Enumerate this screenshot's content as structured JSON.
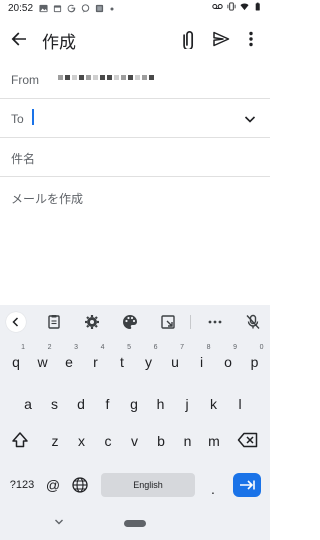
{
  "status_bar": {
    "time": "20:52",
    "left_icons": [
      "image-icon",
      "calendar-icon",
      "google-icon",
      "chat-icon",
      "photos-icon",
      "dot-icon"
    ],
    "right_icons": [
      "voicemail-icon",
      "vibrate-icon",
      "wifi-icon",
      "battery-icon"
    ]
  },
  "app_bar": {
    "title": "作成",
    "back_icon": "arrow-back-icon",
    "attach_icon": "paperclip-icon",
    "send_icon": "send-icon",
    "more_icon": "more-vert-icon"
  },
  "compose": {
    "from_label": "From",
    "from_value_redacted": true,
    "to_label": "To",
    "to_value": "",
    "subject_label": "件名",
    "body_placeholder": "メールを作成"
  },
  "keyboard": {
    "toolbar": [
      "back-icon",
      "clipboard-icon",
      "settings-icon",
      "palette-icon",
      "resize-icon",
      "more-icon",
      "mic-off-icon"
    ],
    "row1": [
      {
        "key": "q",
        "hint": "1"
      },
      {
        "key": "w",
        "hint": "2"
      },
      {
        "key": "e",
        "hint": "3"
      },
      {
        "key": "r",
        "hint": "4"
      },
      {
        "key": "t",
        "hint": "5"
      },
      {
        "key": "y",
        "hint": "6"
      },
      {
        "key": "u",
        "hint": "7"
      },
      {
        "key": "i",
        "hint": "8"
      },
      {
        "key": "o",
        "hint": "9"
      },
      {
        "key": "p",
        "hint": "0"
      }
    ],
    "row2": [
      "a",
      "s",
      "d",
      "f",
      "g",
      "h",
      "j",
      "k",
      "l"
    ],
    "row3": [
      "z",
      "x",
      "c",
      "v",
      "b",
      "n",
      "m"
    ],
    "symbols_key": "?123",
    "at_key": "@",
    "space_label": "English",
    "period_key": "."
  },
  "colors": {
    "accent": "#1a73e8",
    "keyboard_bg": "#eef0f4",
    "text": "#202124",
    "secondary_text": "#5f6368"
  }
}
